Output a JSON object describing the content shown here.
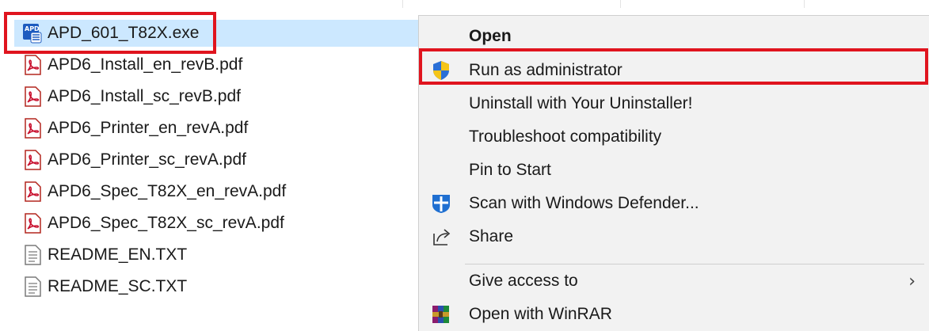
{
  "file_list": {
    "files": [
      {
        "name": "APD_601_T82X.exe",
        "icon": "apd-exe-icon",
        "selected": true
      },
      {
        "name": "APD6_Install_en_revB.pdf",
        "icon": "pdf-icon"
      },
      {
        "name": "APD6_Install_sc_revB.pdf",
        "icon": "pdf-icon"
      },
      {
        "name": "APD6_Printer_en_revA.pdf",
        "icon": "pdf-icon"
      },
      {
        "name": "APD6_Printer_sc_revA.pdf",
        "icon": "pdf-icon"
      },
      {
        "name": "APD6_Spec_T82X_en_revA.pdf",
        "icon": "pdf-icon"
      },
      {
        "name": "APD6_Spec_T82X_sc_revA.pdf",
        "icon": "pdf-icon"
      },
      {
        "name": "README_EN.TXT",
        "icon": "text-file-icon"
      },
      {
        "name": "README_SC.TXT",
        "icon": "text-file-icon"
      }
    ]
  },
  "context_menu": {
    "items": [
      {
        "label": "Open",
        "bold": true
      },
      {
        "label": "Run as administrator",
        "icon": "uac-shield-icon"
      },
      {
        "label": "Uninstall with Your Uninstaller!"
      },
      {
        "label": "Troubleshoot compatibility"
      },
      {
        "label": "Pin to Start"
      },
      {
        "label": "Scan with Windows Defender...",
        "icon": "windows-defender-icon"
      },
      {
        "label": "Share",
        "icon": "share-icon"
      },
      {
        "label": "Give access to",
        "submenu": true
      },
      {
        "label": "Open with WinRAR",
        "icon": "winrar-icon"
      }
    ],
    "submenu_glyph": "›"
  },
  "colors": {
    "highlight_border": "#e0141e",
    "selection": "#cce8ff",
    "menu_background": "#f2f2f2"
  }
}
